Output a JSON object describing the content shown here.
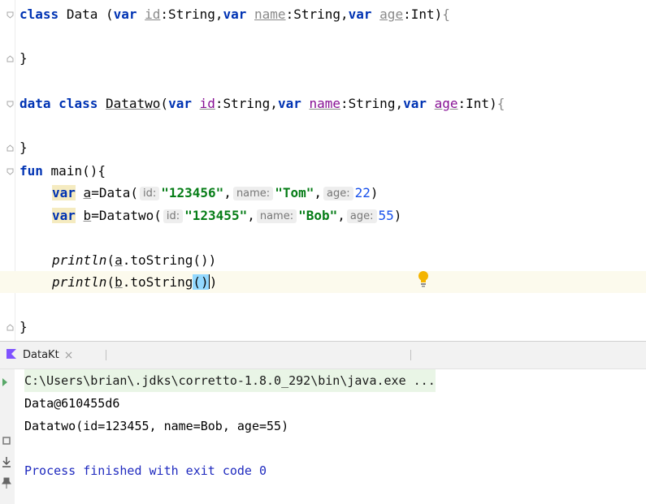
{
  "editor": {
    "line1": {
      "kw": "class",
      "name": "Data",
      "open": " (",
      "var1": "var",
      "p1": "id",
      "t1": ":String,",
      "var2": "var",
      "p2": "name",
      "t2": ":String,",
      "var3": "var",
      "p3": "age",
      "t3": ":Int)",
      "brace": "{"
    },
    "line3": {
      "brace": "}"
    },
    "line5": {
      "kw1": "data",
      "kw2": "class",
      "name": "Datatwo",
      "open": "(",
      "var1": "var",
      "p1": "id",
      "t1": ":String,",
      "var2": "var",
      "p2": "name",
      "t2": ":String,",
      "var3": "var",
      "p3": "age",
      "t3": ":Int)",
      "brace": "{"
    },
    "line7": {
      "brace": "}"
    },
    "line8": {
      "kw": "fun",
      "rest": " main(){"
    },
    "line9": {
      "kw": "var",
      "v": "a",
      "eq": "=Data(",
      "h1": "id:",
      "s1": "\"123456\"",
      "c1": ",",
      "h2": "name:",
      "s2": "\"Tom\"",
      "c2": ",",
      "h3": "age:",
      "n3": "22",
      "close": ")"
    },
    "line10": {
      "kw": "var",
      "v": "b",
      "eq": "=Datatwo(",
      "h1": "id:",
      "s1": "\"123455\"",
      "c1": ",",
      "h2": "name:",
      "s2": "\"Bob\"",
      "c2": ",",
      "h3": "age:",
      "n3": "55",
      "close": ")"
    },
    "line12": {
      "fn": "println",
      "open": "(",
      "v": "a",
      "rest": ".toString())"
    },
    "line13": {
      "fn": "println",
      "open": "(",
      "v": "b",
      "rest": ".toString",
      "p": "()",
      "close": ")"
    },
    "line15": {
      "brace": "}"
    }
  },
  "run_panel": {
    "tab_label": "DataKt",
    "tab_close": "×",
    "console": {
      "cmd": "C:\\Users\\brian\\.jdks\\corretto-1.8.0_292\\bin\\java.exe ...",
      "out1": "Data@610455d6",
      "out2": "Datatwo(id=123455, name=Bob, age=55)",
      "exit": "Process finished with exit code 0"
    }
  },
  "colors": {
    "keyword": "#0033b3",
    "string": "#067d17",
    "number": "#1750eb",
    "property": "#871094",
    "current_line": "#fcfaed",
    "exit_text": "#1f2abf"
  },
  "icons": [
    "fold-icon",
    "lightbulb-icon",
    "kotlin-run-icon",
    "rerun-icon",
    "stop-icon",
    "pin-icon"
  ]
}
